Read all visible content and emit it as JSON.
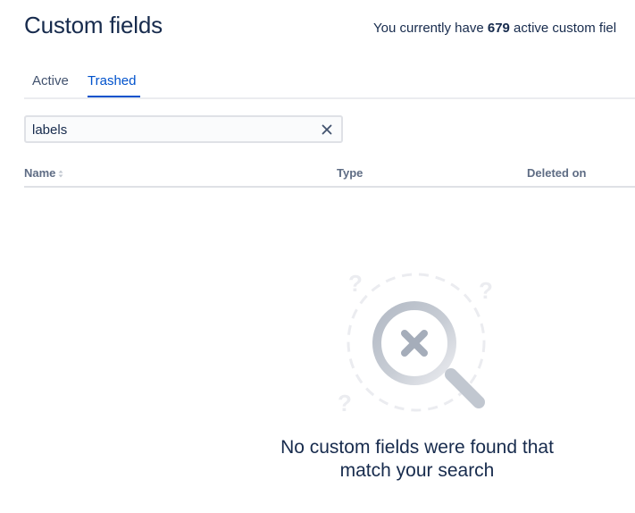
{
  "header": {
    "title": "Custom fields",
    "summary_prefix": "You currently have ",
    "summary_count": "679",
    "summary_suffix": " active custom fiel"
  },
  "tabs": [
    {
      "label": "Active",
      "selected": false
    },
    {
      "label": "Trashed",
      "selected": true
    }
  ],
  "search": {
    "value": "labels",
    "placeholder": ""
  },
  "table": {
    "columns": [
      {
        "label": "Name",
        "sortable": true
      },
      {
        "label": "Type",
        "sortable": false
      },
      {
        "label": "Deleted on",
        "sortable": false
      }
    ]
  },
  "empty_state": {
    "line1": "No custom fields were found that",
    "line2": "match your search",
    "icon": "magnifier-x-icon"
  },
  "colors": {
    "primary_text": "#172B4D",
    "accent_blue": "#0052CC",
    "muted_text": "#5E6C84",
    "border": "#DFE1E6"
  }
}
